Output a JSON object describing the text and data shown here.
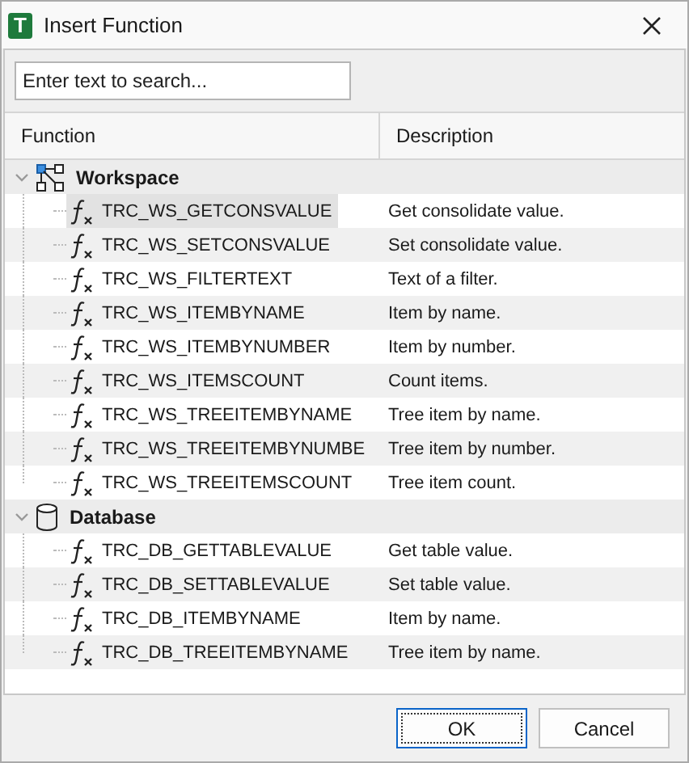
{
  "window": {
    "title": "Insert Function",
    "logo": "T"
  },
  "search": {
    "placeholder": "Enter text to search..."
  },
  "columns": [
    "Function",
    "Description"
  ],
  "groups": [
    {
      "name": "Workspace",
      "kind": "workspace",
      "expanded": true,
      "children": [
        {
          "name": "TRC_WS_GETCONSVALUE",
          "description": "Get consolidate value.",
          "selected": true
        },
        {
          "name": "TRC_WS_SETCONSVALUE",
          "description": "Set consolidate value.",
          "selected": false
        },
        {
          "name": "TRC_WS_FILTERTEXT",
          "description": "Text of a filter.",
          "selected": false
        },
        {
          "name": "TRC_WS_ITEMBYNAME",
          "description": "Item by name.",
          "selected": false
        },
        {
          "name": "TRC_WS_ITEMBYNUMBER",
          "description": "Item by number.",
          "selected": false
        },
        {
          "name": "TRC_WS_ITEMSCOUNT",
          "description": "Count items.",
          "selected": false
        },
        {
          "name": "TRC_WS_TREEITEMBYNAME",
          "description": "Tree item by name.",
          "selected": false
        },
        {
          "name": "TRC_WS_TREEITEMBYNUMBE",
          "description": "Tree item by number.",
          "selected": false
        },
        {
          "name": "TRC_WS_TREEITEMSCOUNT",
          "description": "Tree item count.",
          "selected": false
        }
      ]
    },
    {
      "name": "Database",
      "kind": "database",
      "expanded": true,
      "children": [
        {
          "name": "TRC_DB_GETTABLEVALUE",
          "description": "Get table value.",
          "selected": false
        },
        {
          "name": "TRC_DB_SETTABLEVALUE",
          "description": "Set table value.",
          "selected": false
        },
        {
          "name": "TRC_DB_ITEMBYNAME",
          "description": "Item by name.",
          "selected": false
        },
        {
          "name": "TRC_DB_TREEITEMBYNAME",
          "description": "Tree item by name.",
          "selected": false
        }
      ]
    }
  ],
  "buttons": [
    {
      "label": "OK",
      "default": true
    },
    {
      "label": "Cancel",
      "default": false
    }
  ]
}
